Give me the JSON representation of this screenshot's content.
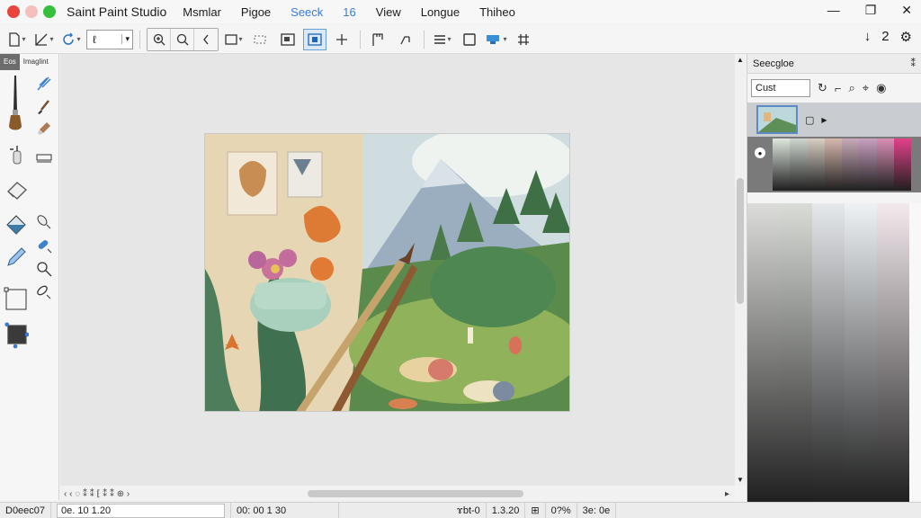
{
  "window": {
    "app_title": "Saint Paint Studio",
    "controls": {
      "minimize": "—",
      "maximize": "❐",
      "close": "✕"
    }
  },
  "menu": [
    {
      "label": "Msmlar"
    },
    {
      "label": "Pigoe"
    },
    {
      "label": "Seeck",
      "accent": true
    },
    {
      "label": "16",
      "accent": true
    },
    {
      "label": "View"
    },
    {
      "label": "Longue"
    },
    {
      "label": "Thiheo"
    }
  ],
  "toolbar": {
    "brush_size_value": "ℓ",
    "right_icons": [
      "↓",
      "2",
      "⚙"
    ]
  },
  "left_panel": {
    "tabs": [
      "Eos",
      "Imaglint"
    ]
  },
  "right_panel": {
    "title": "Seecgloe",
    "search_value": "Cust",
    "palette": [
      "#dfe7df",
      "#cdd6cf",
      "#d8cfc4",
      "#d7b8ad",
      "#c9a9b8",
      "#c9a0c1",
      "#d98fb5",
      "#e3418a"
    ],
    "gradient": [
      "#dcdcda",
      "#d9dcd7",
      "#e6e9ec",
      "#eef2f5",
      "#f3eaee"
    ]
  },
  "scrollbar": {
    "nav_icons": "‹ ‹ ◌ ⁑ ⁑ ⁅ ⁑ ⁑ ⊕ ›"
  },
  "status": {
    "doc": "D0eec07",
    "zoom": "0e. 10 1.20",
    "coords": "00: 00 1 30",
    "misc": "ɤbt-0",
    "scale": "1.3.20",
    "pct": "0?%",
    "tail": "3e: 0e"
  }
}
